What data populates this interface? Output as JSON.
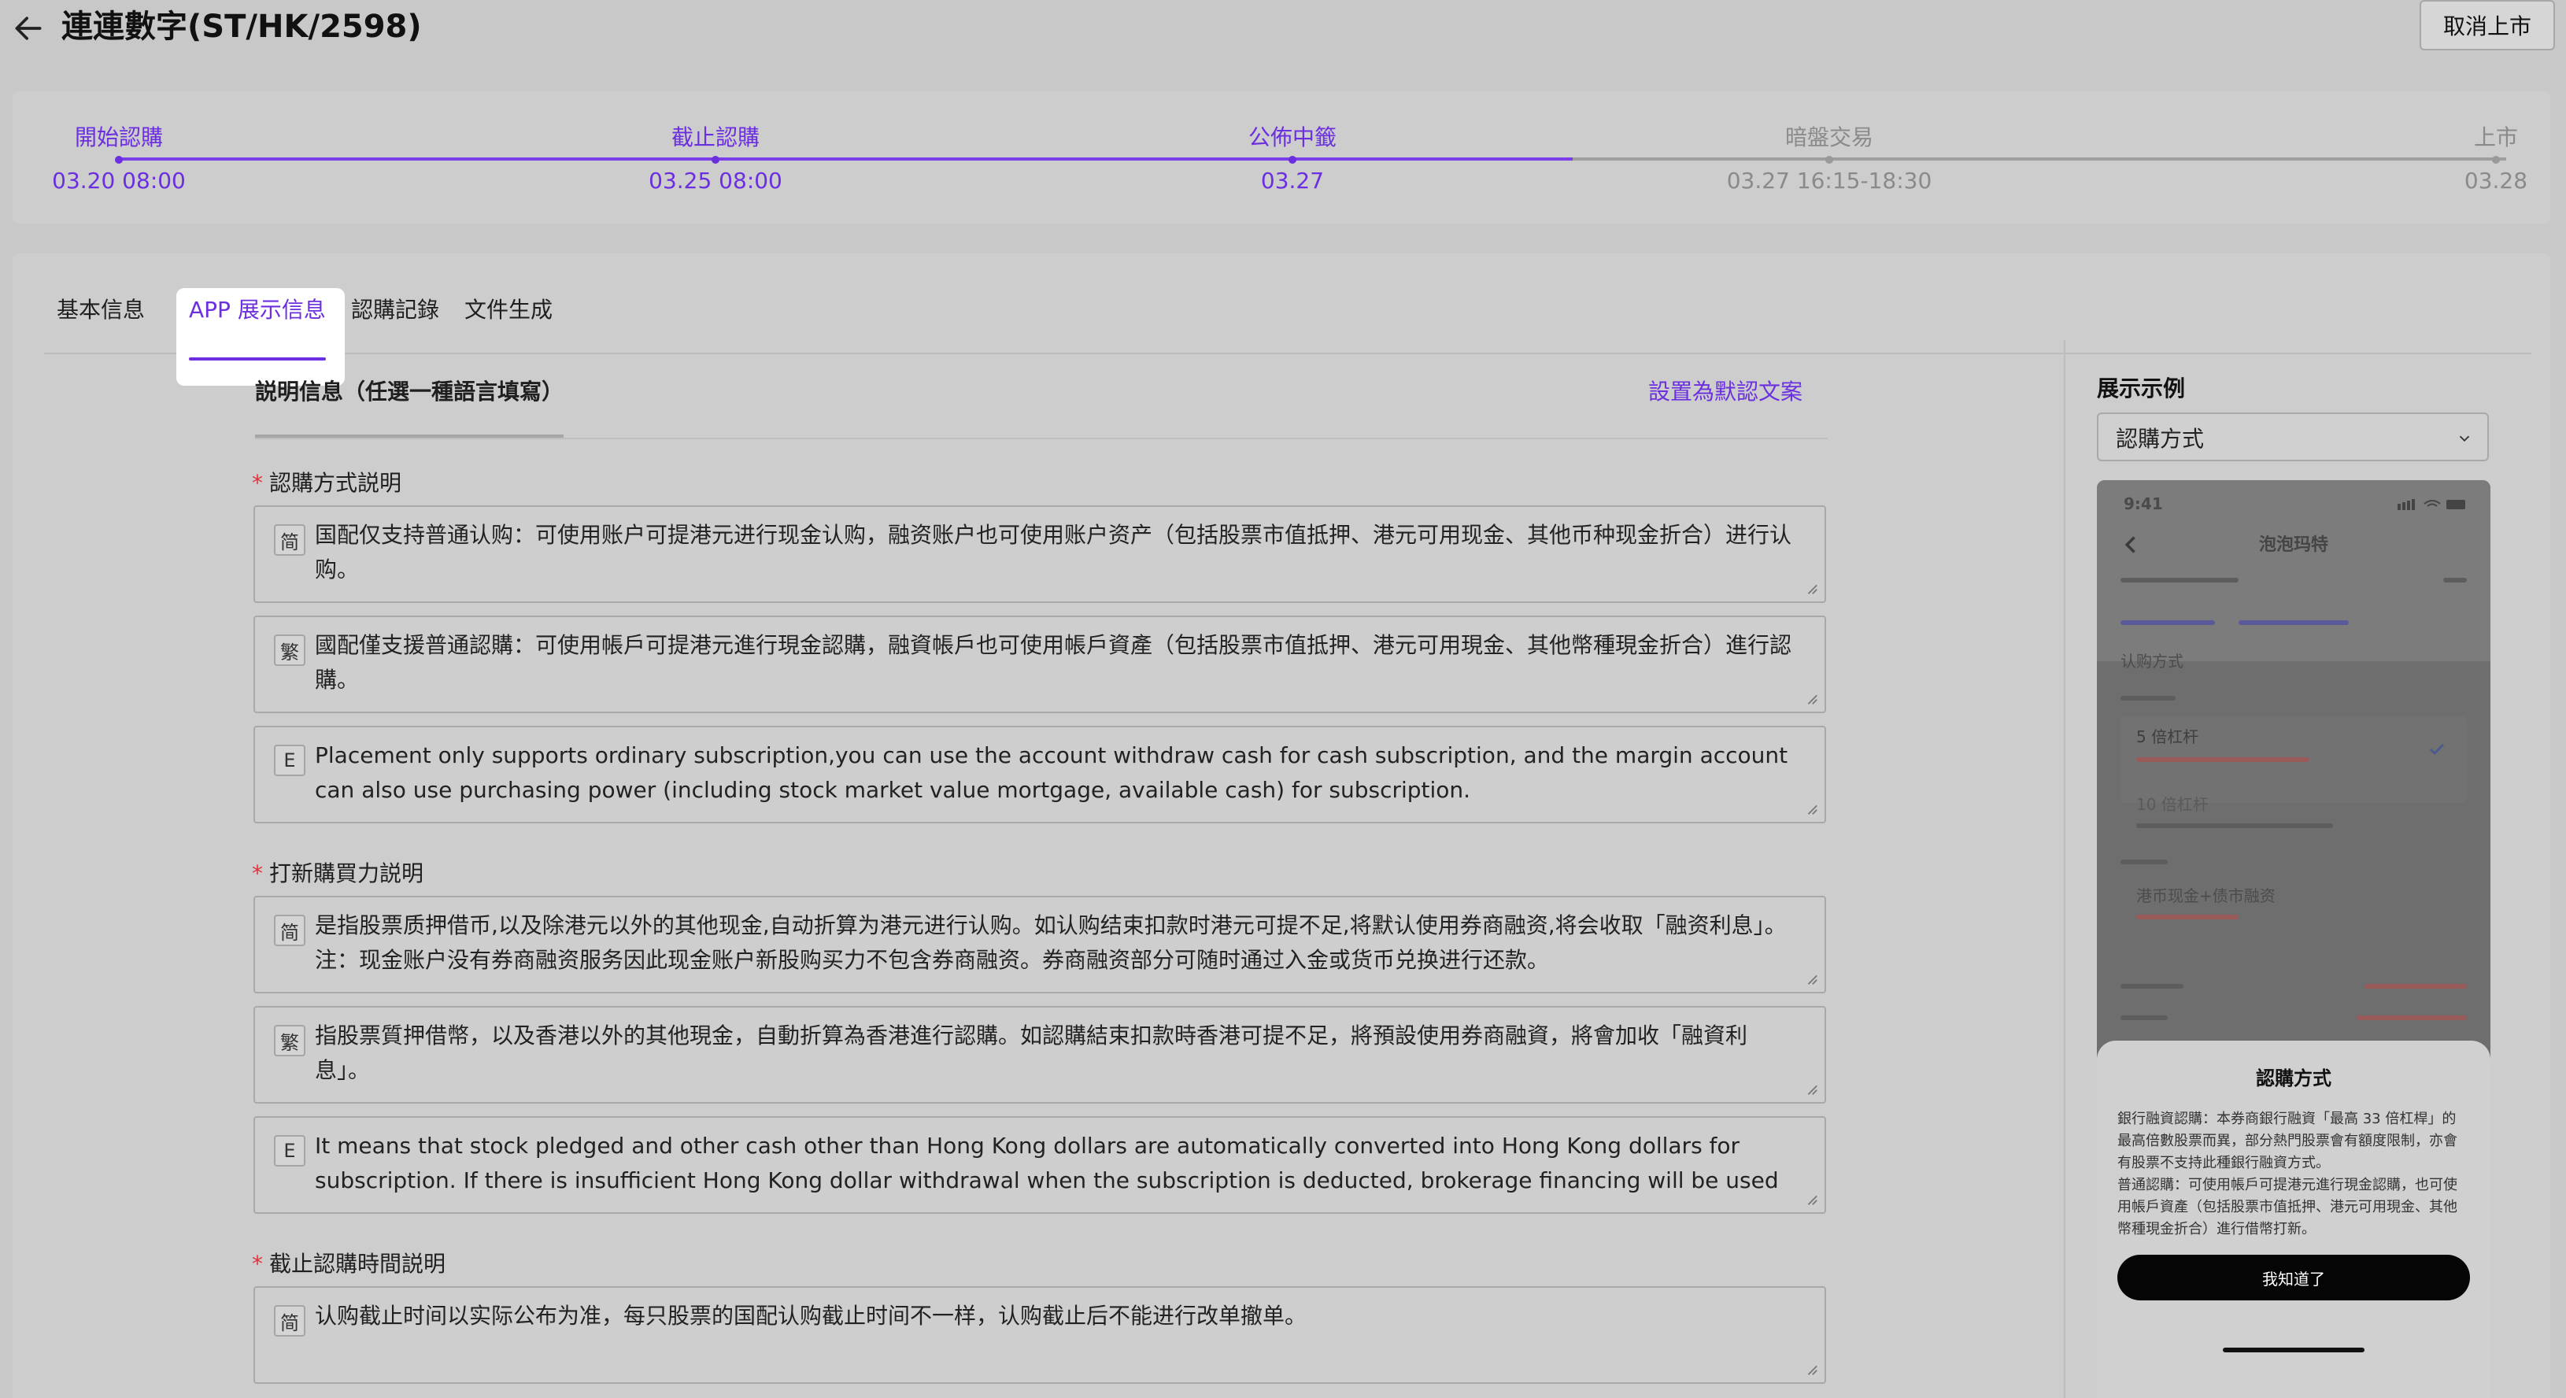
{
  "header": {
    "title": "連連數字(ST/HK/2598)",
    "cancel_button": "取消上市"
  },
  "timeline": {
    "steps": [
      {
        "label": "開始認購",
        "date": "03.20 08:00",
        "state": "active"
      },
      {
        "label": "截止認購",
        "date": "03.25 08:00",
        "state": "active"
      },
      {
        "label": "公佈中籤",
        "date": "03.27",
        "state": "active"
      },
      {
        "label": "暗盤交易",
        "date": "03.27 16:15-18:30",
        "state": "inactive"
      },
      {
        "label": "上市",
        "date": "03.28",
        "state": "inactive"
      }
    ],
    "progress_fraction": 0.61,
    "colors": {
      "active": "#6b2fe0",
      "inactive": "#8a8a8a"
    }
  },
  "tabs": [
    {
      "label": "基本信息",
      "active": false
    },
    {
      "label": "APP 展示信息",
      "active": true
    },
    {
      "label": "認購記錄",
      "active": false
    },
    {
      "label": "文件生成",
      "active": false
    }
  ],
  "form": {
    "section_title": "説明信息（任選一種語言填寫）",
    "default_link": "設置為默認文案",
    "fields": [
      {
        "label": "認購方式説明",
        "required": true,
        "entries": [
          {
            "lang": "简",
            "text": "国配仅支持普通认购：可使用账户可提港元进行现金认购，融资账户也可使用账户资产（包括股票市值抵押、港元可用现金、其他币种现金折合）进行认购。"
          },
          {
            "lang": "繁",
            "text": "國配僅支援普通認購：可使用帳戶可提港元進行現金認購，融資帳戶也可使用帳戶資產（包括股票市值抵押、港元可用現金、其他幣種現金折合）進行認購。"
          },
          {
            "lang": "E",
            "text": "Placement only supports ordinary subscription,you can use the account withdraw cash for cash subscription, and the margin account can also use purchasing power (including stock market value mortgage, available cash) for subscription."
          }
        ]
      },
      {
        "label": "打新購買力説明",
        "required": true,
        "entries": [
          {
            "lang": "简",
            "text": "是指股票质押借币,以及除港元以外的其他现金,自动折算为港元进行认购。如认购结束扣款时港元可提不足,将默认使用券商融资,将会收取「融资利息」。注：现金账户没有券商融资服务因此现金账户新股购买力不包含券商融资。券商融资部分可随时通过入金或货币兑换进行还款。"
          },
          {
            "lang": "繁",
            "text": "指股票質押借幣，以及香港以外的其他現金，自動折算為香港進行認購。如認購結束扣款時香港可提不足，將預設使用券商融資，將會加收「融資利息」。"
          },
          {
            "lang": "E",
            "text": "It means that stock pledged and other cash other than Hong Kong dollars are automatically converted into Hong Kong dollars for subscription. If there is insufficient Hong Kong dollar withdrawal when the subscription is deducted, brokerage financing will be used by default and \"financing"
          }
        ]
      },
      {
        "label": "截止認購時間説明",
        "required": true,
        "entries": [
          {
            "lang": "简",
            "text": "认购截止时间以实际公布为准，每只股票的国配认购截止时间不一样，认购截止后不能进行改单撤单。"
          }
        ]
      }
    ]
  },
  "preview": {
    "title": "展示示例",
    "select_value": "認購方式",
    "phone": {
      "time": "9:41",
      "stock_name": "泡泡玛特",
      "subscribe_mode_label": "认购方式",
      "option1": "5 倍杠杆",
      "option2": "10 倍杠杆",
      "option3": "港币现金+债市融资",
      "sheet_title": "認購方式",
      "sheet_body": "銀行融資認購：本券商銀行融資「最高 33 倍杠桿」的最高倍數股票而異，部分熱門股票會有額度限制，亦會有股票不支持此種銀行融資方式。\n普通認購：可使用帳戶可提港元進行現金認購，也可使用帳戶資產（包括股票市值抵押、港元可用現金、其他幣種現金折合）進行借幣打新。",
      "sheet_button": "我知道了"
    }
  }
}
